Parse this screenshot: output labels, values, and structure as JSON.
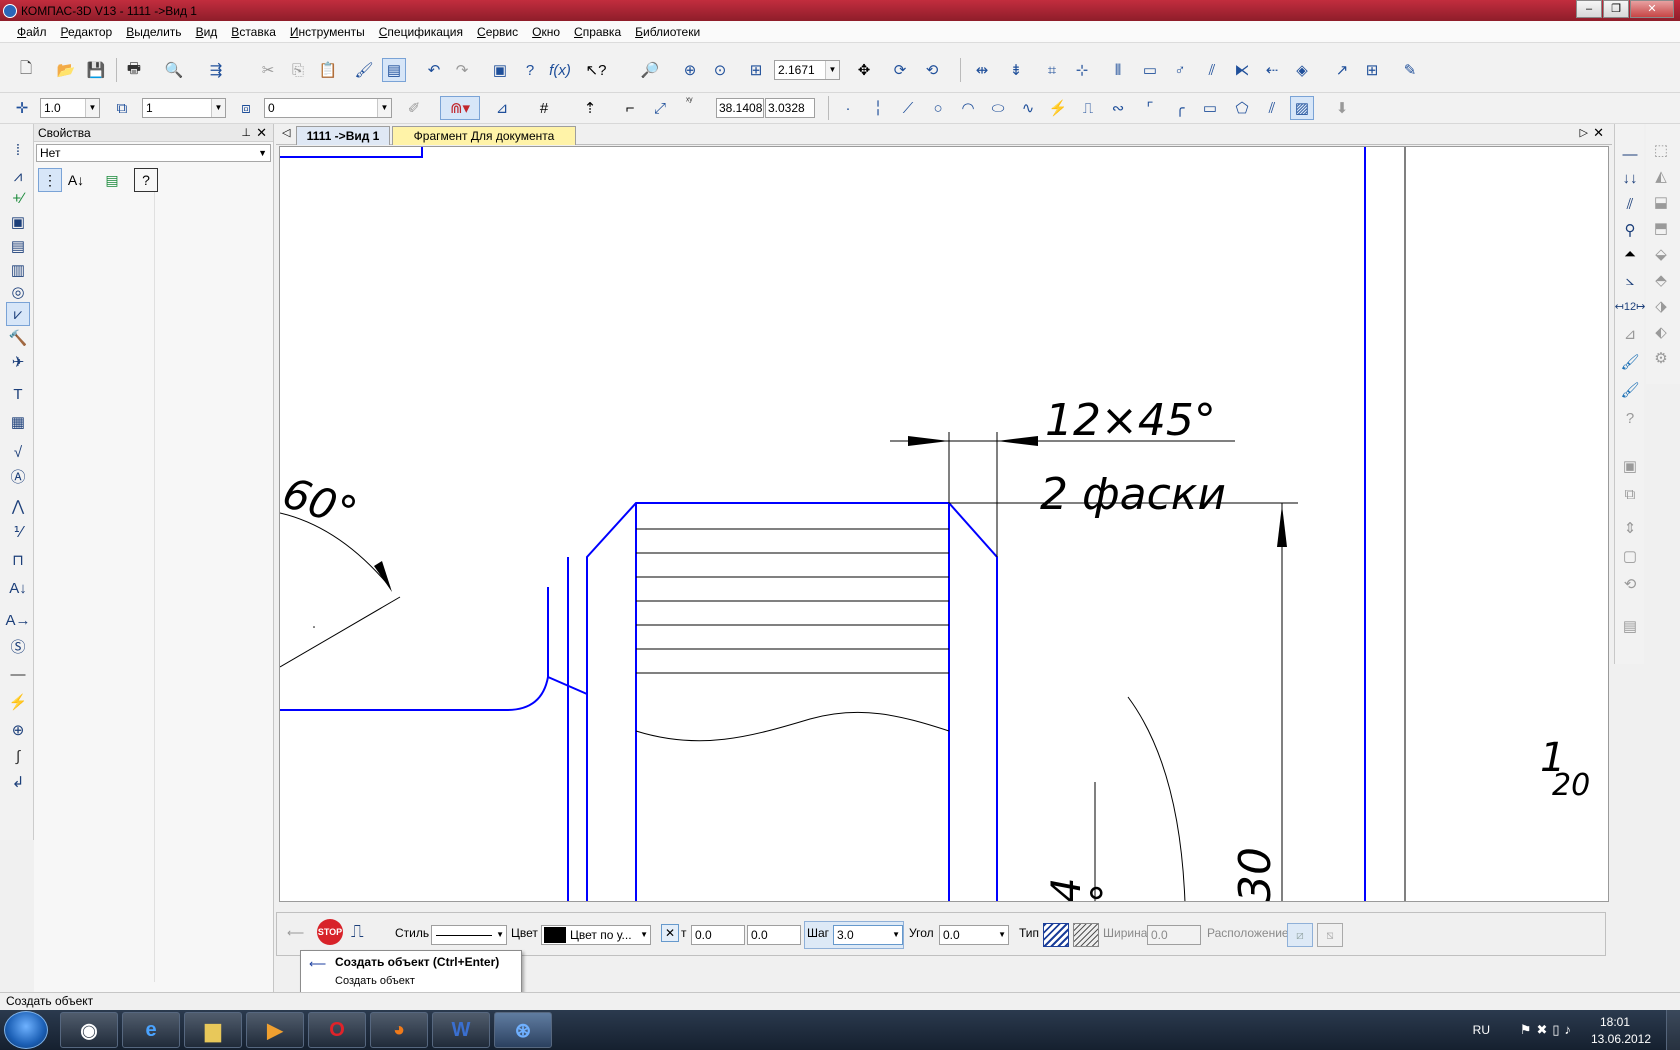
{
  "window": {
    "title": "КОМПАС-3D V13 - 1111 ->Вид 1",
    "minimize": "–",
    "maximize": "❐",
    "close": "✕"
  },
  "menu": [
    "Файл",
    "Редактор",
    "Выделить",
    "Вид",
    "Вставка",
    "Инструменты",
    "Спецификация",
    "Сервис",
    "Окно",
    "Справка",
    "Библиотеки"
  ],
  "toolbar_main": {
    "zoom_value": "2.1671"
  },
  "toolbar_current": {
    "scale_value": "1.0",
    "state_value": "1",
    "layer_value": "0",
    "coord_x": "38.1408",
    "coord_y": "3.0328"
  },
  "properties_panel": {
    "title": "Свойства",
    "selector_value": "Нет"
  },
  "tabs": {
    "active": "1111 ->Вид 1",
    "other": "Фрагмент Для документа"
  },
  "drawing": {
    "angle_label": "60°",
    "chamfer_size": "12×45°",
    "chamfer_count": "2 фаски",
    "scale_number": "1",
    "scale_subscript": "20",
    "dim_30": "30",
    "dim_4": "4",
    "dim_partial_deg": "°",
    "colors": {
      "geometry": "#0000ff",
      "dimension": "#000000"
    }
  },
  "parameters": {
    "style_label": "Стиль",
    "color_label": "Цвет",
    "color_value": "Цвет по у...",
    "x_label": "т",
    "x_value": "0.0",
    "y_value": "0.0",
    "step_label": "Шаг",
    "step_value": "3.0",
    "angle_label": "Угол",
    "angle_value": "0.0",
    "type_label": "Тип",
    "width_label": "Ширина",
    "width_value": "0.0",
    "placement_label": "Расположение"
  },
  "tooltip": {
    "title": "Создать объект (Ctrl+Enter)",
    "description": "Создать объект"
  },
  "status": "Создать объект",
  "taskbar": {
    "lang": "RU",
    "time": "18:01",
    "date": "13.06.2012"
  }
}
